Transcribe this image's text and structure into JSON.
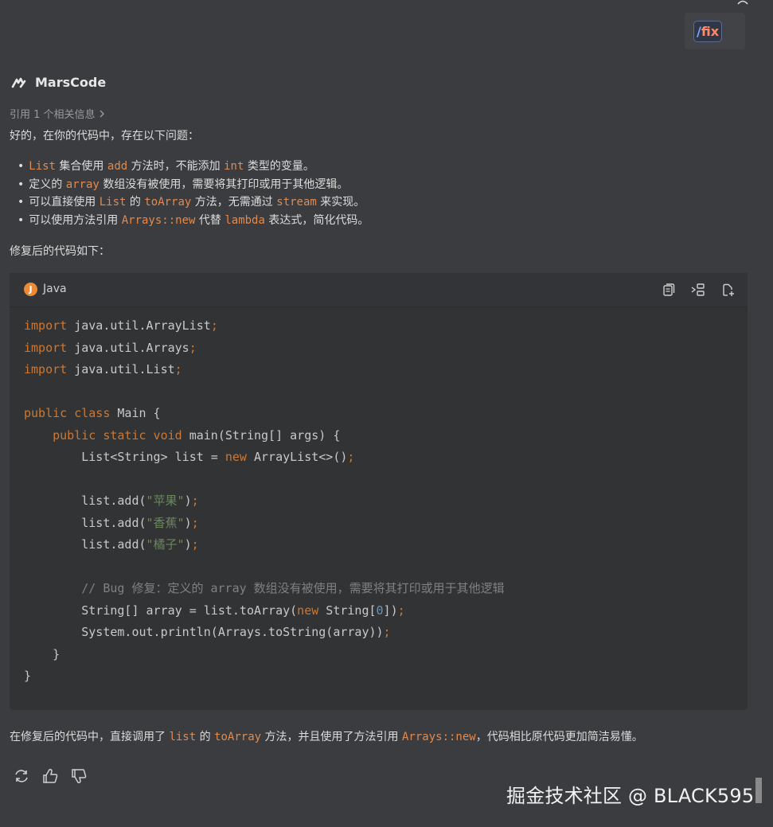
{
  "top_command": {
    "label_slash": "/",
    "label_word": "fix"
  },
  "header": {
    "brand": "MarsCode"
  },
  "reference": {
    "label": "引用 1 个相关信息"
  },
  "intro": "好的，在你的代码中，存在以下问题：",
  "issues": [
    {
      "bullet": "•",
      "c1": "List",
      "t1": " 集合使用 ",
      "c2": "add",
      "t2": " 方法时，不能添加 ",
      "c3": "int",
      "t3": " 类型的变量。"
    },
    {
      "bullet": "•",
      "t0": "定义的 ",
      "c1": "array",
      "t1": " 数组没有被使用，需要将其打印或用于其他逻辑。"
    },
    {
      "bullet": "•",
      "t0": "可以直接使用 ",
      "c1": "List",
      "t1": " 的 ",
      "c2": "toArray",
      "t2": " 方法，无需通过 ",
      "c3": "stream",
      "t3": " 来实现。"
    },
    {
      "bullet": "•",
      "t0": "可以使用方法引用 ",
      "c1": "Arrays::new",
      "t1": " 代替 ",
      "c2": "lambda",
      "t2": " 表达式，简化代码。"
    }
  ],
  "after_title": "修复后的代码如下：",
  "code_block": {
    "language": "Java",
    "lang_badge": "J",
    "lines": [
      [
        [
          "kw",
          "import"
        ],
        [
          "pl",
          " java.util.ArrayList"
        ],
        [
          "kw",
          ";"
        ]
      ],
      [
        [
          "kw",
          "import"
        ],
        [
          "pl",
          " java.util.Arrays"
        ],
        [
          "kw",
          ";"
        ]
      ],
      [
        [
          "kw",
          "import"
        ],
        [
          "pl",
          " java.util.List"
        ],
        [
          "kw",
          ";"
        ]
      ],
      [],
      [
        [
          "kw",
          "public class"
        ],
        [
          "pl",
          " Main {"
        ]
      ],
      [
        [
          "pl",
          "    "
        ],
        [
          "kw",
          "public static void"
        ],
        [
          "pl",
          " main(String[] args) {"
        ]
      ],
      [
        [
          "pl",
          "        List<String> list = "
        ],
        [
          "kw",
          "new"
        ],
        [
          "pl",
          " ArrayList<>()"
        ],
        [
          "kw",
          ";"
        ]
      ],
      [],
      [
        [
          "pl",
          "        list.add("
        ],
        [
          "str",
          "\"苹果\""
        ],
        [
          "pl",
          ")"
        ],
        [
          "kw",
          ";"
        ]
      ],
      [
        [
          "pl",
          "        list.add("
        ],
        [
          "str",
          "\"香蕉\""
        ],
        [
          "pl",
          ")"
        ],
        [
          "kw",
          ";"
        ]
      ],
      [
        [
          "pl",
          "        list.add("
        ],
        [
          "str",
          "\"橘子\""
        ],
        [
          "pl",
          ")"
        ],
        [
          "kw",
          ";"
        ]
      ],
      [],
      [
        [
          "pl",
          "        "
        ],
        [
          "com",
          "// Bug 修复：定义的 array 数组没有被使用，需要将其打印或用于其他逻辑"
        ]
      ],
      [
        [
          "pl",
          "        String[] array = list.toArray("
        ],
        [
          "kw",
          "new"
        ],
        [
          "pl",
          " String["
        ],
        [
          "num",
          "0"
        ],
        [
          "pl",
          "])"
        ],
        [
          "kw",
          ";"
        ]
      ],
      [
        [
          "pl",
          "        System.out.println(Arrays.toString(array))"
        ],
        [
          "kw",
          ";"
        ]
      ],
      [
        [
          "pl",
          "    }"
        ]
      ],
      [
        [
          "pl",
          "}"
        ]
      ]
    ]
  },
  "summary": {
    "t0": "在修复后的代码中，直接调用了 ",
    "c1": "list",
    "t1": " 的 ",
    "c2": "toArray",
    "t2": " 方法，并且使用了方法引用 ",
    "c3": "Arrays::new",
    "t3": "，代码相比原代码更加简洁易懂。"
  },
  "watermark": "掘金技术社区 @ BLACK595",
  "colors": {
    "background": "#3b3c3f",
    "code_background": "#323335",
    "keyword": "#cc7832",
    "string": "#6a8759",
    "number": "#6897bb",
    "comment": "#808080",
    "inline_code": "#e08a4f"
  },
  "icons": [
    "corner-icon",
    "marscode-logo-icon",
    "chevron-right-icon",
    "java-icon",
    "copy-icon",
    "insert-code-icon",
    "new-file-icon",
    "regenerate-icon",
    "thumbs-up-icon",
    "thumbs-down-icon"
  ]
}
